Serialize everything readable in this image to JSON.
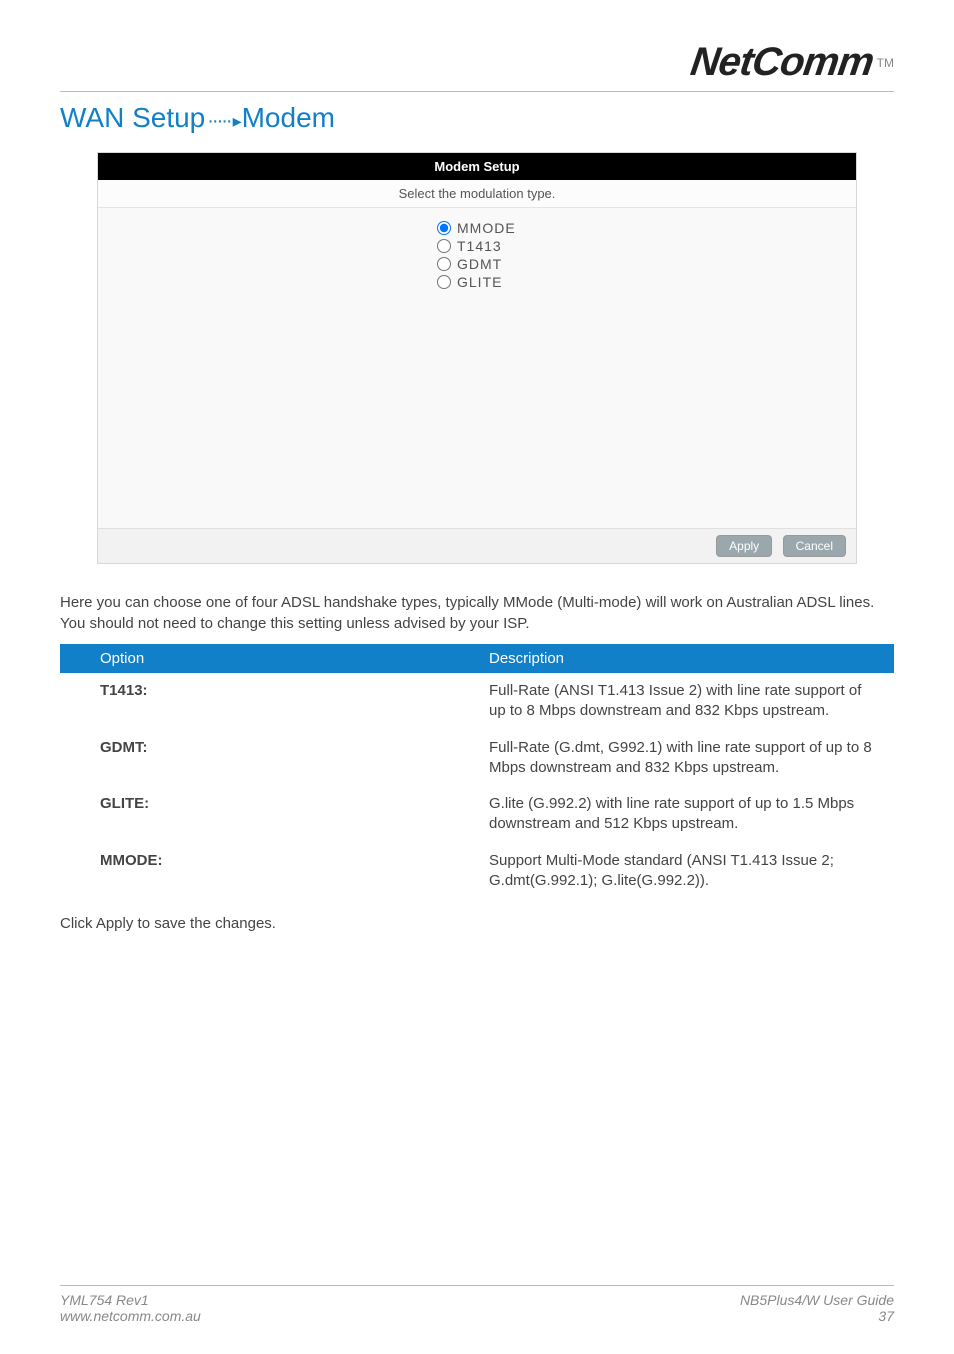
{
  "brand": {
    "name": "NetComm",
    "tm": "TM"
  },
  "section": {
    "prefix": "WAN Setup",
    "suffix": "Modem"
  },
  "modem_panel": {
    "header": "Modem Setup",
    "subheader": "Select the modulation type.",
    "options": [
      "MMODE",
      "T1413",
      "GDMT",
      "GLITE"
    ],
    "selected": "MMODE",
    "apply": "Apply",
    "cancel": "Cancel"
  },
  "intro_para": "Here you can choose one of four ADSL handshake types, typically MMode (Multi-mode) will work on Australian ADSL lines. You should not need to change this setting unless advised by your ISP.",
  "table": {
    "headers": [
      "Option",
      "Description"
    ],
    "rows": [
      {
        "option": "T1413:",
        "desc": "Full-Rate (ANSI T1.413 Issue 2) with line rate support of up to 8 Mbps downstream and 832 Kbps upstream."
      },
      {
        "option": "GDMT:",
        "desc": "Full-Rate (G.dmt, G992.1) with line rate support of up to 8 Mbps downstream and 832 Kbps upstream."
      },
      {
        "option": "GLITE:",
        "desc": "G.lite (G.992.2) with line rate support of up to 1.5 Mbps downstream and 512 Kbps upstream."
      },
      {
        "option": "MMODE:",
        "desc": "Support Multi-Mode standard (ANSI T1.413 Issue 2; G.dmt(G.992.1); G.lite(G.992.2))."
      }
    ]
  },
  "closing": "Click Apply to save the changes.",
  "footer": {
    "left1": "YML754 Rev1",
    "left2": "www.netcomm.com.au",
    "right1": "NB5Plus4/W User Guide",
    "right2": "37"
  }
}
